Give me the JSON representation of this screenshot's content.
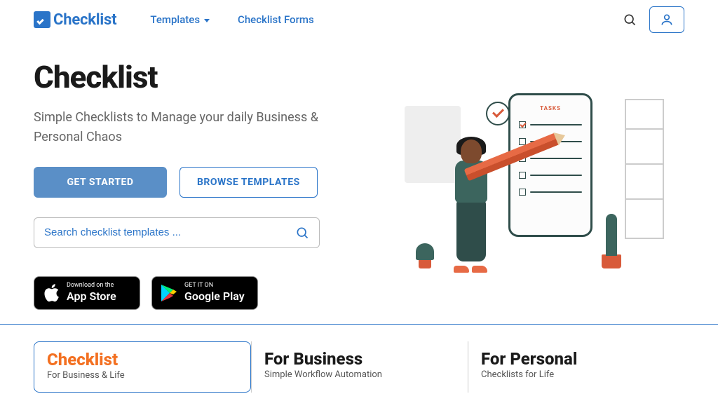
{
  "brand": {
    "name": "Checklist"
  },
  "nav": {
    "templates": "Templates",
    "forms": "Checklist Forms"
  },
  "hero": {
    "title": "Checklist",
    "subtitle": "Simple Checklists to Manage your daily Business & Personal Chaos",
    "get_started": "GET STARTED",
    "browse": "BROWSE TEMPLATES",
    "search_placeholder": "Search checklist templates ..."
  },
  "illustration": {
    "board_title": "TASKS"
  },
  "stores": {
    "apple_small": "Download on the",
    "apple_big": "App Store",
    "google_small": "GET IT ON",
    "google_big": "Google Play"
  },
  "tabs": [
    {
      "title": "Checklist",
      "sub": "For Business & Life"
    },
    {
      "title": "For Business",
      "sub": "Simple Workflow Automation"
    },
    {
      "title": "For Personal",
      "sub": "Checklists for Life"
    }
  ]
}
